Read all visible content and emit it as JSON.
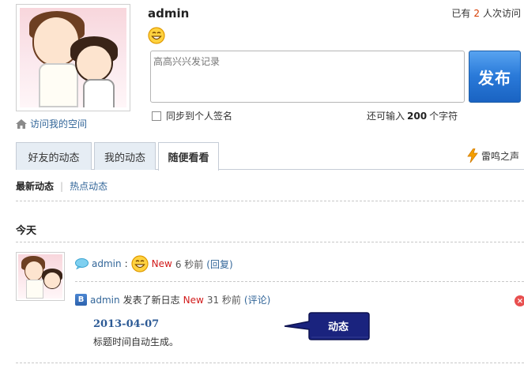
{
  "profile": {
    "username": "admin",
    "home_link": "访问我的空间",
    "visit_prefix": "已有",
    "visit_count": "2",
    "visit_suffix": "人次访问"
  },
  "status_box": {
    "placeholder": "高高兴兴发记录",
    "publish_label": "发布",
    "sync_label": "同步到个人签名",
    "remaining_prefix": "还可输入",
    "remaining_count": "200",
    "remaining_suffix": "个字符"
  },
  "tabs": {
    "items": [
      {
        "label": "好友的动态",
        "active": false
      },
      {
        "label": "我的动态",
        "active": false
      },
      {
        "label": "随便看看",
        "active": true
      }
    ],
    "thunder_label": "雷鸣之声"
  },
  "subtabs": {
    "latest": "最新动态",
    "hot": "热点动态"
  },
  "feed": {
    "group_label": "今天",
    "items": [
      {
        "user": "admin",
        "separator": ":",
        "new_label": "New",
        "time": "6 秒前",
        "action": "(回复)"
      },
      {
        "user": "admin",
        "verb": "发表了新日志",
        "new_label": "New",
        "time": "31 秒前",
        "action": "(评论)",
        "blog_title": "2013-04-07",
        "blog_desc": "标题时间自动生成。"
      }
    ]
  },
  "callout": {
    "label": "动态"
  },
  "colors": {
    "link": "#336699",
    "new_tag": "#d11a1a",
    "publish_button": "#2a7ad9",
    "callout_fill": "#1a237e",
    "visit_count": "#d63b00"
  },
  "icons": {
    "home": "home-icon",
    "smiley": "smiley-icon",
    "bubble": "speech-bubble-icon",
    "blog": "blog-icon",
    "thunder": "lightning-icon",
    "delete": "delete-icon"
  }
}
